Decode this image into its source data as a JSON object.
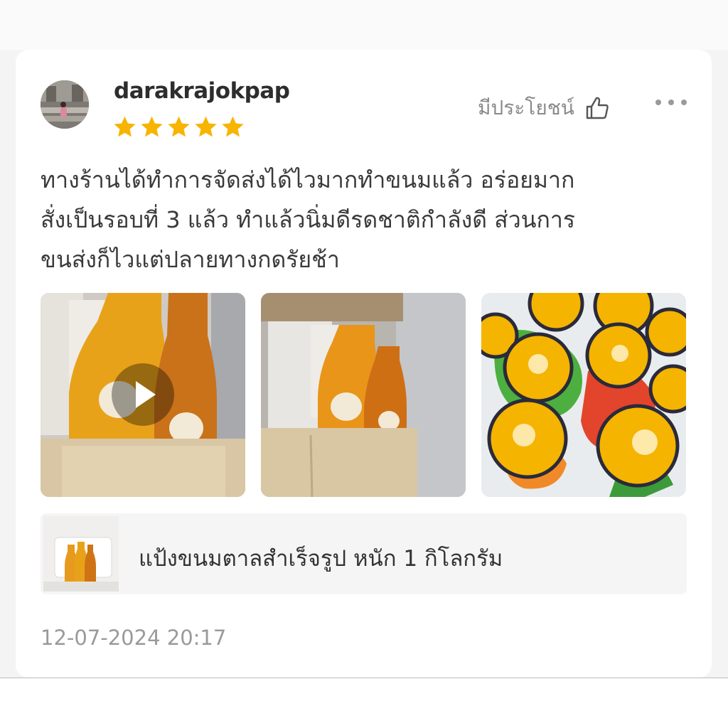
{
  "review": {
    "username": "darakrajokpap",
    "rating": 5,
    "rating_max": 5,
    "helpful_label": "มีประโยชน์",
    "text_lines": [
      "ทางร้านได้ทำการจัดส่งได้ไวมากทำขนมแล้ว อร่อยมาก",
      "สั่งเป็นรอบที่ 3 แล้ว ทำแล้วนิ่มดีรดชาติกำลังดี ส่วนการ",
      "ขนส่งก็ไวแต่ปลายทางกดรัยช้า"
    ],
    "media": [
      {
        "type": "video",
        "name": "video-thumbnail-bottles"
      },
      {
        "type": "photo",
        "name": "photo-box-bottles"
      },
      {
        "type": "photo",
        "name": "photo-coconut-cakes"
      }
    ],
    "timestamp": "12-07-2024 20:17"
  },
  "product": {
    "name": "แป้งขนมตาลสำเร็จรูป หนัก 1 กิโลกรัม"
  },
  "icons": {
    "star": "star-icon",
    "helpful": "thumbs-up-icon",
    "more": "more-icon",
    "play": "play-icon"
  },
  "colors": {
    "star": "#f7b400",
    "text": "#3a3a3a",
    "muted": "#8a8a8a"
  }
}
